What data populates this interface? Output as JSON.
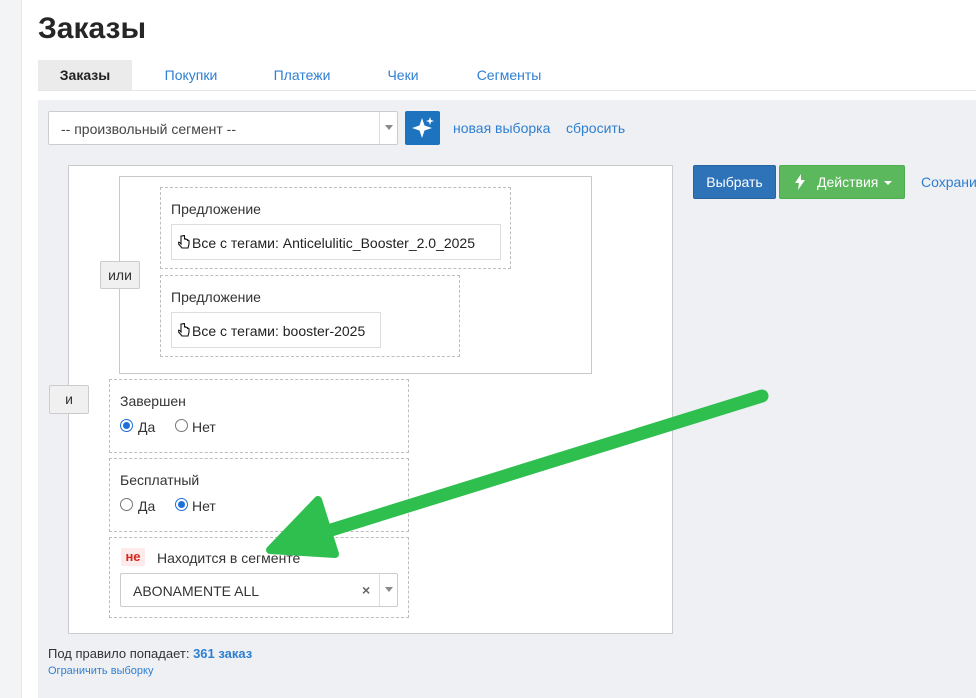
{
  "page": {
    "title": "Заказы"
  },
  "tabs": [
    {
      "label": "Заказы",
      "active": true
    },
    {
      "label": "Покупки",
      "active": false
    },
    {
      "label": "Платежи",
      "active": false
    },
    {
      "label": "Чеки",
      "active": false
    },
    {
      "label": "Сегменты",
      "active": false
    }
  ],
  "toolbar": {
    "segment_select_value": "-- произвольный сегмент --",
    "new_selection_link": "новая выборка",
    "reset_link": "сбросить",
    "choose_button": "Выбрать",
    "actions_button": "Действия",
    "save_link": "Сохрани"
  },
  "rules": {
    "or_button": "или",
    "and_button": "и",
    "offer_1": {
      "label": "Предложение",
      "value": "Все с тегами: Anticelulitic_Booster_2.0_2025"
    },
    "offer_2": {
      "label": "Предложение",
      "value": "Все с тегами: booster-2025"
    },
    "completed": {
      "label": "Завершен",
      "yes": "Да",
      "no": "Нет",
      "selected": "yes"
    },
    "free": {
      "label": "Бесплатный",
      "yes": "Да",
      "no": "Нет",
      "selected": "no"
    },
    "segment": {
      "negation": "не",
      "label": "Находится в сегменте",
      "value": "ABONAMENTE ALL",
      "clear": "×"
    }
  },
  "footer": {
    "matches_prefix": "Под правило попадает:",
    "matches_count": "361 заказ",
    "limit_link": "Ограничить выборку"
  },
  "colors": {
    "primary": "#2e73b8",
    "success": "#5cb85c",
    "link": "#2f7fd1",
    "annotation_arrow": "#2fbf4f",
    "negation": "#d9261c"
  },
  "icons": {
    "magic": "sparkles-icon",
    "offer": "pointing-hand-icon",
    "actions": "lightning-icon"
  }
}
